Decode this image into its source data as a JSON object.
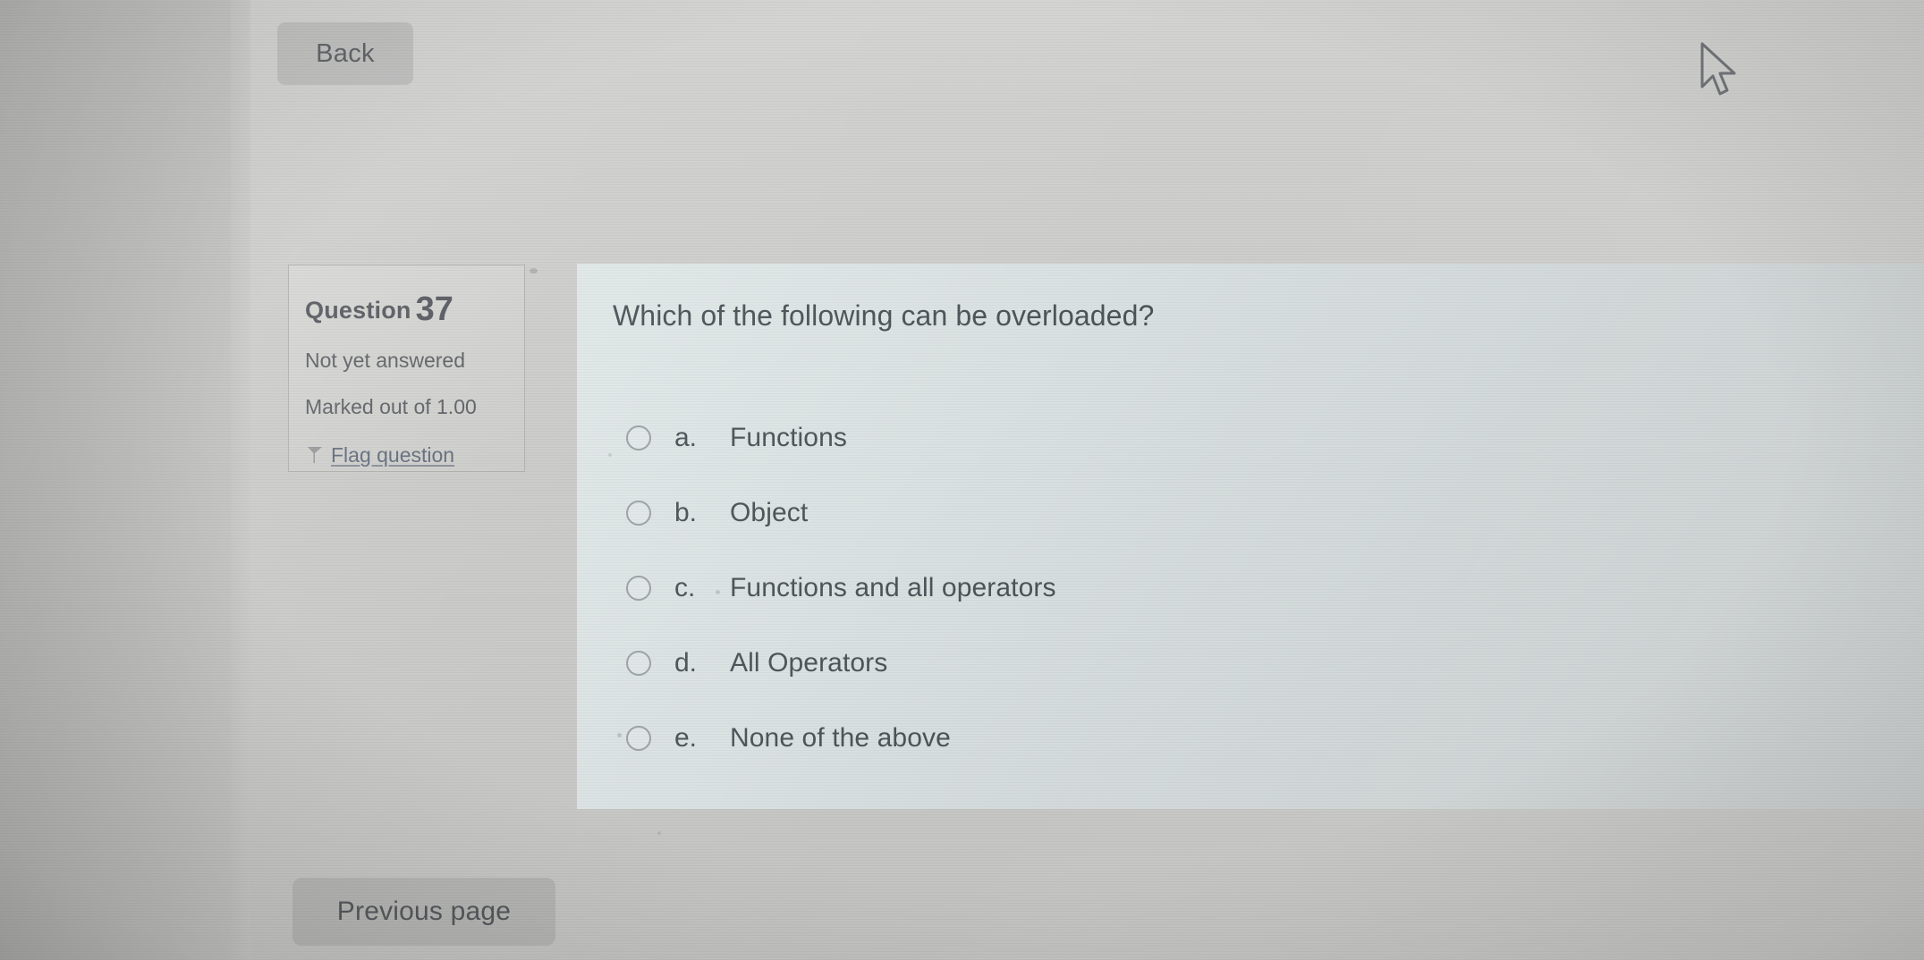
{
  "nav": {
    "back_label": "Back",
    "previous_page_label": "Previous page"
  },
  "question_info": {
    "heading_label": "Question",
    "number": "37",
    "status": "Not yet answered",
    "marks": "Marked out of 1.00",
    "flag_label": "Flag question",
    "flag_icon": "flag-icon"
  },
  "question": {
    "text": "Which of the following can be overloaded?",
    "options": [
      {
        "letter": "a.",
        "label": "Functions",
        "selected": false
      },
      {
        "letter": "b.",
        "label": "Object",
        "selected": false
      },
      {
        "letter": "c.",
        "label": "Functions and all operators",
        "selected": false
      },
      {
        "letter": "d.",
        "label": "All Operators",
        "selected": false
      },
      {
        "letter": "e.",
        "label": "None of the above",
        "selected": false
      }
    ]
  },
  "cursor": {
    "icon": "mouse-pointer-icon"
  },
  "colors": {
    "page_background": "#c9c9c7",
    "panel_background": "#dde5e5",
    "text": "#4a5155",
    "muted_text": "#5b5e63",
    "link": "#5f6a7a",
    "button_background": "#aaaaaa"
  }
}
